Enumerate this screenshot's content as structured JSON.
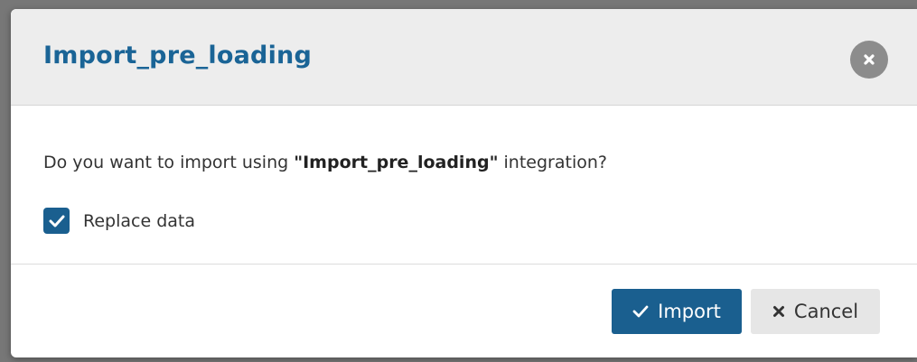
{
  "dialog": {
    "title": "Import_pre_loading",
    "question_prefix": "Do you want to import using ",
    "integration_name": "\"Import_pre_loading\"",
    "question_suffix": " integration?",
    "replace_data": {
      "label": "Replace data",
      "checked": true
    },
    "buttons": {
      "import_label": "Import",
      "cancel_label": "Cancel"
    }
  },
  "icons": {
    "close": "close-icon",
    "checkbox": "checkmark-icon",
    "import": "checkmark-icon",
    "cancel": "x-icon"
  },
  "colors": {
    "title": "#1a6496",
    "primary_button": "#1a5f8f",
    "checkbox": "#1a5f8f",
    "close_button": "#8c8c8c",
    "header_background": "#ededed",
    "secondary_button": "#e6e6e6"
  }
}
